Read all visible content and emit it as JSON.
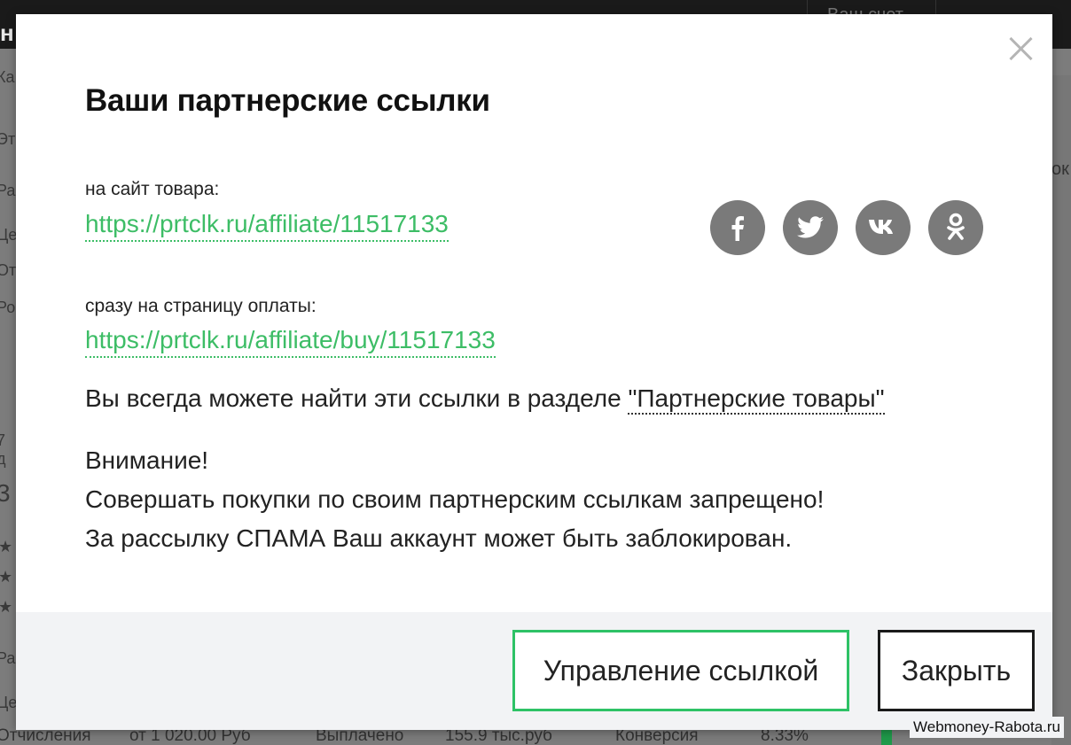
{
  "background": {
    "brand_fragment": "н",
    "account_fragment": "Ваш счет",
    "left_letters": [
      "Ка",
      "Эт",
      "Ра",
      "Це",
      "Отч",
      "Ро",
      "7 д",
      "3",
      "★",
      "★",
      "★",
      "Ра",
      "Це"
    ],
    "right_fragment": "ок",
    "bottom_row": {
      "label1": "Отчисления",
      "value1": "от 1 020.00 Руб",
      "label2": "Выплачено",
      "value2": "155.9 тыс.руб",
      "label3": "Конверсия",
      "value3": "8.33%"
    }
  },
  "modal": {
    "title": "Ваши партнерские ссылки",
    "product_label": "на сайт товара:",
    "product_link": "https://prtclk.ru/affiliate/11517133",
    "payment_label": "сразу на страницу оплаты:",
    "payment_link": "https://prtclk.ru/affiliate/buy/11517133",
    "info_prefix": "Вы всегда можете найти эти ссылки в разделе ",
    "info_section": "\"Партнерские товары\"",
    "warning_lines": [
      "Внимание!",
      "Совершать покупки по своим партнерским ссылкам запрещено!",
      "За рассылку СПАМА Ваш аккаунт может быть заблокирован."
    ],
    "social_icons": [
      "facebook-icon",
      "twitter-icon",
      "vk-icon",
      "odnoklassniki-icon"
    ],
    "buttons": {
      "manage": "Управление ссылкой",
      "close": "Закрыть"
    }
  },
  "watermark": "Webmoney-Rabota.ru",
  "colors": {
    "link_green": "#3dbd66",
    "manage_border": "#2ec266",
    "social_bg": "#7a7a7a"
  }
}
